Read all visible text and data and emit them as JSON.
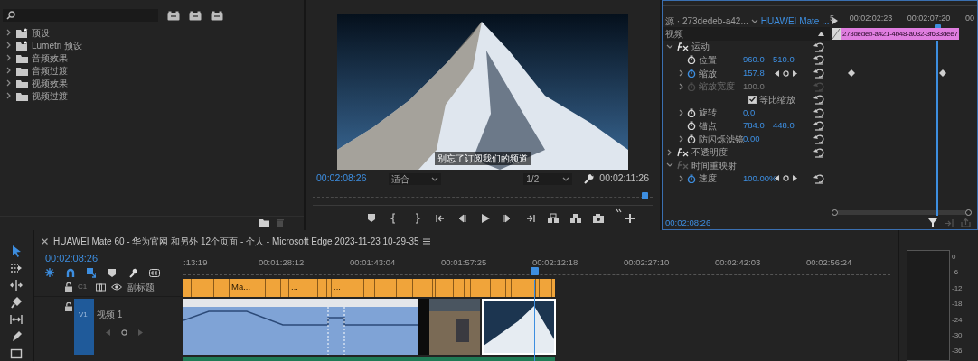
{
  "effects_panel": {
    "items": [
      {
        "label": "预设",
        "kind": "preset_bin",
        "expanded": false
      },
      {
        "label": "Lumetri 预设",
        "kind": "preset_bin",
        "expanded": false
      },
      {
        "label": "音频效果",
        "kind": "folder",
        "expanded": false
      },
      {
        "label": "音频过渡",
        "kind": "folder",
        "expanded": false
      },
      {
        "label": "视频效果",
        "kind": "folder",
        "expanded": false
      },
      {
        "label": "视频过渡",
        "kind": "folder",
        "expanded": false
      }
    ]
  },
  "program_monitor": {
    "subtitle": "别忘了订阅我们的频道",
    "current_time": "00:02:08:26",
    "zoom": "适合",
    "resolution": "1/2",
    "duration": "00:02:11:26",
    "playhead": {
      "level": 0.98
    }
  },
  "effect_controls": {
    "source": "源 · 273dedeb-a42...",
    "sequence": "HUAWEI Mate ...",
    "ruler": [
      "5",
      "00:02:02:23",
      "00:02:07:20",
      "00"
    ],
    "clip_name": "273dedeb-a421-4b48-a032-3f633dee7",
    "section": "视频",
    "rows": [
      {
        "kind": "effect",
        "label": "运动",
        "expanded": true,
        "enabled": true,
        "resettable": true
      },
      {
        "kind": "property",
        "label": "位置",
        "values": [
          "960.0",
          "510.0"
        ],
        "expandable": false,
        "animated": false,
        "disabled": false,
        "keyframe_nav": false,
        "has_keyframes": false
      },
      {
        "kind": "property",
        "label": "缩放",
        "values": [
          "157.8"
        ],
        "expandable": true,
        "animated": true,
        "disabled": false,
        "keyframe_nav": true,
        "has_keyframes": true
      },
      {
        "kind": "property",
        "label": "缩放宽度",
        "values": [
          "100.0"
        ],
        "expandable": true,
        "animated": false,
        "disabled": true,
        "keyframe_nav": false,
        "has_keyframes": false
      },
      {
        "kind": "checkbox",
        "label": "等比缩放",
        "checked": true
      },
      {
        "kind": "property",
        "label": "旋转",
        "values": [
          "0.0"
        ],
        "expandable": true,
        "animated": false,
        "disabled": false,
        "keyframe_nav": false,
        "has_keyframes": false
      },
      {
        "kind": "property",
        "label": "锚点",
        "values": [
          "784.0",
          "448.0"
        ],
        "expandable": false,
        "animated": false,
        "disabled": false,
        "keyframe_nav": false,
        "has_keyframes": false
      },
      {
        "kind": "property",
        "label": "防闪烁滤镜",
        "values": [
          "0.00"
        ],
        "expandable": true,
        "animated": false,
        "disabled": false,
        "keyframe_nav": false,
        "has_keyframes": false
      },
      {
        "kind": "effect",
        "label": "不透明度",
        "expanded": false,
        "enabled": true,
        "resettable": true
      },
      {
        "kind": "effect",
        "label": "时间重映射",
        "expanded": true,
        "enabled": false,
        "resettable": false
      },
      {
        "kind": "property",
        "label": "速度",
        "values": [
          "100.00%"
        ],
        "expandable": true,
        "animated": true,
        "disabled": false,
        "keyframe_nav": true,
        "has_keyframes": false
      }
    ],
    "playhead": {
      "level": 0.73
    },
    "current_time": "00:02:08:26"
  },
  "tools": [
    {
      "kind": "selection",
      "selected": true
    },
    {
      "kind": "track_select",
      "selected": false
    },
    {
      "kind": "ripple",
      "selected": false
    },
    {
      "kind": "razor",
      "selected": false
    },
    {
      "kind": "slip",
      "selected": false
    },
    {
      "kind": "pen",
      "selected": false
    },
    {
      "kind": "rectangle",
      "selected": false
    }
  ],
  "timeline": {
    "sequence_title": "HUAWEI Mate 60 - 华为官网 和另外 12个页面 - 个人 - Microsoft Edge 2023-11-23 10-29-35",
    "current_time": "00:02:08:26",
    "ruler": [
      ":13:19",
      "00:01:28:12",
      "00:01:43:04",
      "00:01:57:25",
      "00:02:12:18",
      "00:02:27:10",
      "00:02:42:03",
      "00:02:56:24"
    ],
    "playhead": {
      "level": 0.496
    },
    "tracks": [
      {
        "kind": "caption",
        "id_label": "C1",
        "name": "副标题",
        "locked": false,
        "clips": [
          {
            "label": "Ma..."
          },
          {
            "label": "..."
          },
          {
            "label": "..."
          }
        ]
      },
      {
        "kind": "video",
        "id_label": "V1",
        "name": "视频 1",
        "locked": false,
        "targeted": true
      }
    ]
  },
  "meter": {
    "scale": [
      "0",
      "-6",
      "-12",
      "-18",
      "-24",
      "-30",
      "-36"
    ]
  }
}
